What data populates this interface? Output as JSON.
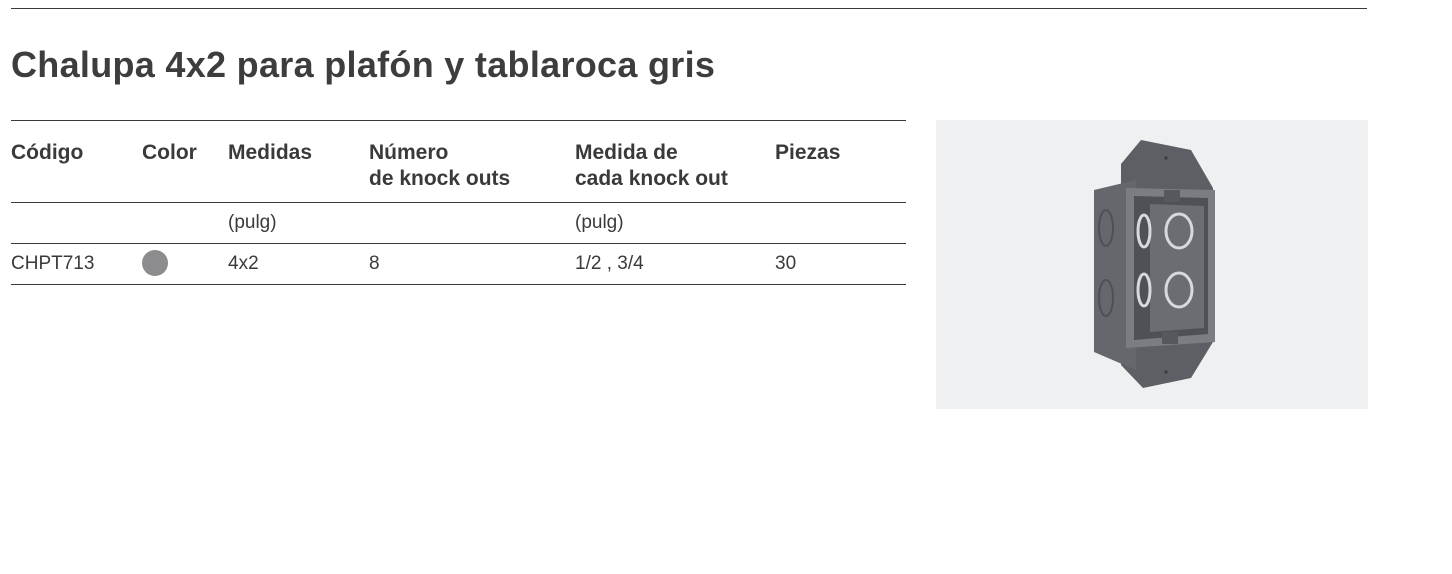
{
  "title": "Chalupa 4x2 para plafón y tablaroca gris",
  "table": {
    "headers": {
      "codigo": "Código",
      "color": "Color",
      "medidas": "Medidas",
      "numero_line1": "Número",
      "numero_line2": "de knock outs",
      "medida_line1": "Medida de",
      "medida_line2": "cada knock out",
      "piezas": "Piezas"
    },
    "units": {
      "medidas": "(pulg)",
      "medida_knock_out": "(pulg)"
    },
    "rows": [
      {
        "codigo": "CHPT713",
        "color_hex": "#8c8c8e",
        "medidas": "4x2",
        "numero_knock_outs": "8",
        "medida_knock_out": "1/2 , 3/4",
        "piezas": "30"
      }
    ]
  },
  "colors": {
    "text": "#3a3a3a",
    "photo_background": "#eef0f2",
    "box_gray": "#6f7276"
  },
  "image": {
    "icon": "electrical-box-photo"
  }
}
